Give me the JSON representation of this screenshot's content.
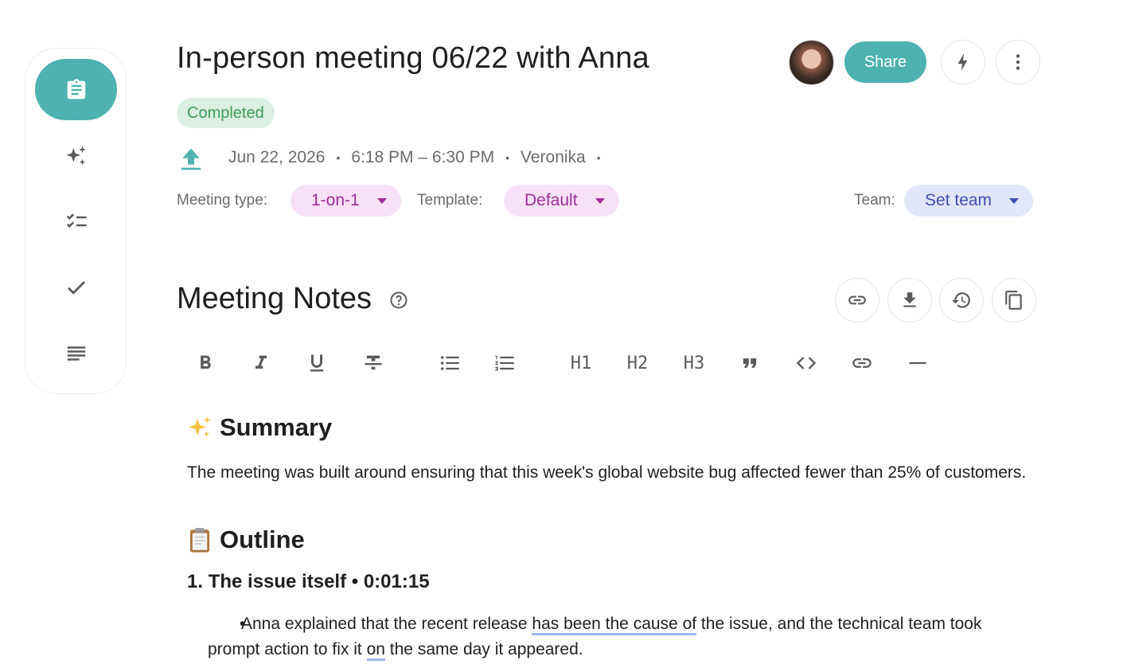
{
  "header": {
    "title": "In-person meeting 06/22 with Anna",
    "share_label": "Share",
    "status_badge": "Completed"
  },
  "meta": {
    "date": "Jun 22, 2026",
    "time": "6:18 PM – 6:30 PM",
    "owner": "Veronika",
    "separator": "•"
  },
  "fields": {
    "meeting_type_label": "Meeting type:",
    "meeting_type_value": "1-on-1",
    "template_label": "Template:",
    "template_value": "Default",
    "team_label": "Team:",
    "team_value": "Set team"
  },
  "notes": {
    "section_title": "Meeting Notes",
    "toolbar": {
      "h1": "H1",
      "h2": "H2",
      "h3": "H3"
    },
    "summary_heading": "Summary",
    "summary_text": "The meeting was built around ensuring that this week's global website bug affected fewer than 25% of customers.",
    "outline_heading": "Outline",
    "item_1_heading": "1. The issue itself • 0:01:15",
    "bullet_1": {
      "part_a": "Anna explained that the recent release ",
      "underlined_a": "has been the cause of",
      "part_b": " the issue, and the technical team took prompt action to fix it ",
      "underlined_b": "on",
      "part_c": " the same day it appeared."
    }
  },
  "icons": {
    "sidebar": [
      "notes-clipboard-icon",
      "sparkles-icon",
      "checklist-icon",
      "check-icon",
      "text-lines-icon"
    ],
    "header": [
      "lightning-icon",
      "more-vertical-icon"
    ],
    "notes_actions": [
      "link-icon",
      "download-icon",
      "history-icon",
      "copy-icon"
    ]
  },
  "colors": {
    "accent": "#4db2b0",
    "completed_bg": "#dcefe3",
    "completed_text": "#3e9b5a",
    "pink_pill_bg": "#f8e1f6",
    "pink_pill_text": "#9a2f97",
    "blue_pill_bg": "#e2e6fb",
    "blue_pill_text": "#3f4eb0"
  }
}
